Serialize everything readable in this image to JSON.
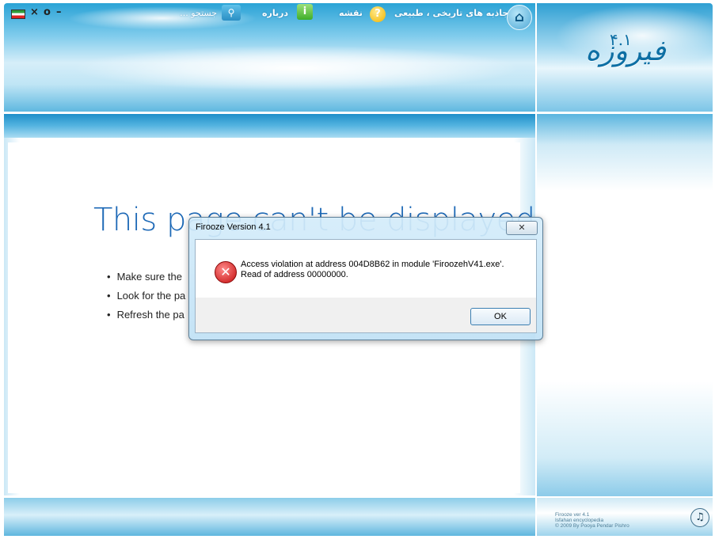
{
  "window": {
    "controls": {
      "close": "×",
      "restore": "o",
      "minimize": "–"
    }
  },
  "toolbar": {
    "search_text": "جستجو ...",
    "search_icon": "search-icon",
    "about_label": "درباره",
    "map_label": "نقشه",
    "attractions_label": "جاذبه های تاریخی ، طبیعی"
  },
  "logo": {
    "text": "فیروزه",
    "version": "۴.۱"
  },
  "ie_page": {
    "title": "This page can't be displayed",
    "items": [
      "Make sure the",
      "Look for the pa",
      "Refresh the pa"
    ]
  },
  "dialog": {
    "title": "Firooze Version 4.1",
    "close_label": "✕",
    "message": "Access violation at address 004D8B62 in module 'FiroozehV41.exe'. Read of address 00000000.",
    "ok_label": "OK"
  },
  "footer": {
    "info": "Firooze ver 4.1\nIsfahan encyclopedia\n© 2009 By Pooya Pendar Pishro",
    "music_icon": "music-note-icon"
  },
  "colors": {
    "accent": "#1c68b6",
    "header": "#2aa3d6",
    "error": "#c40d0d"
  }
}
